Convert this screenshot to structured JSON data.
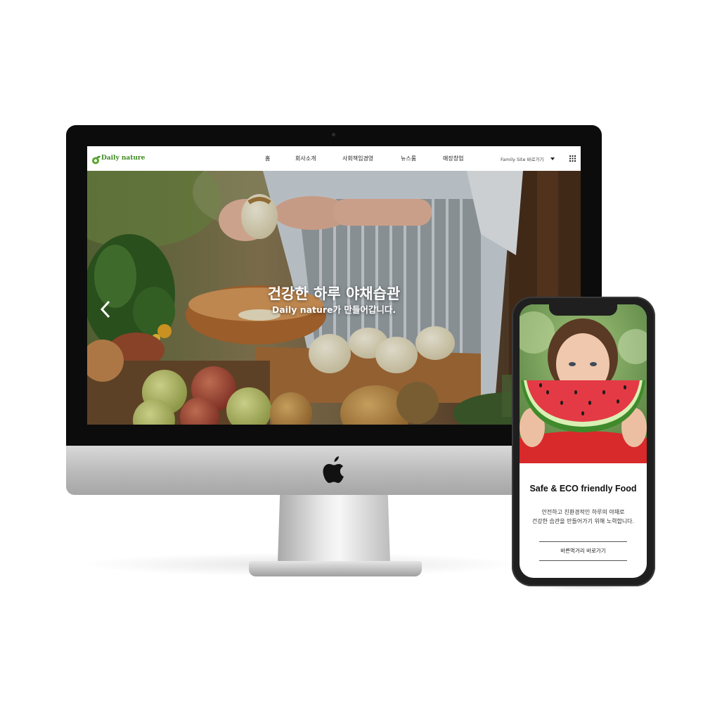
{
  "site": {
    "logo_text": "Daily nature",
    "nav": [
      "홈",
      "회사소개",
      "사회책임경영",
      "뉴스룸",
      "매장창업"
    ],
    "family_site": "Family Site 바로가기",
    "hero": {
      "title": "건강한 하루 야채습관",
      "subtitle": "Daily nature가 만들어갑니다."
    }
  },
  "mobile": {
    "heading": "Safe & ECO friendly Food",
    "description": [
      "안전하고 친환경적인 하루의 야채로",
      "건강한 습관을 만들어가기 위해 노력합니다."
    ],
    "link_label": "바른먹거리 바로가기"
  },
  "colors": {
    "brand_green": "#3d8a21",
    "imac_bezel": "#0c0c0c",
    "phone_body": "#1f1f1f"
  },
  "icons": [
    "apple-logo-icon",
    "chevron-left-icon",
    "caret-down-icon",
    "grid-menu-icon",
    "leaf-logo-icon"
  ]
}
